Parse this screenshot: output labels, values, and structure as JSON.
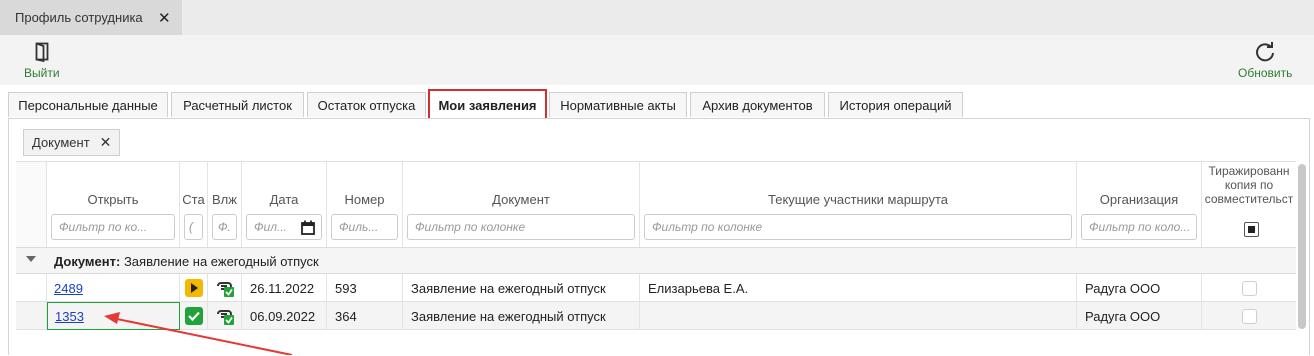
{
  "doc_tab": {
    "title": "Профиль сотрудника"
  },
  "toolbar": {
    "exit_label": "Выйти",
    "refresh_label": "Обновить"
  },
  "tabs": [
    {
      "label": "Персональные данные"
    },
    {
      "label": "Расчетный листок"
    },
    {
      "label": "Остаток отпуска"
    },
    {
      "label": "Мои заявления"
    },
    {
      "label": "Нормативные акты"
    },
    {
      "label": "Архив документов"
    },
    {
      "label": "История операций"
    }
  ],
  "grouping_chip": {
    "label": "Документ"
  },
  "columns": {
    "open": {
      "label": "Открыть",
      "filter": "Фильтр по ко..."
    },
    "status": {
      "label": "Ста"
    },
    "attach": {
      "label": "Влж"
    },
    "date": {
      "label": "Дата",
      "filter": "Фил..."
    },
    "number": {
      "label": "Номер",
      "filter": "Филь..."
    },
    "document": {
      "label": "Документ",
      "filter": "Фильтр по колонке"
    },
    "participants": {
      "label": "Текущие участники маршрута",
      "filter": "Фильтр по колонке"
    },
    "org": {
      "label": "Организация",
      "filter": "Фильтр по коло..."
    },
    "copy": {
      "label_line1": "Тиражированн",
      "label_line2": "копия по",
      "label_line3": "совместительст"
    }
  },
  "group": {
    "key": "Документ:",
    "value": "Заявление на ежегодный отпуск"
  },
  "rows": [
    {
      "open": "2489",
      "status": "in-progress",
      "date": "26.11.2022",
      "number": "593",
      "document": "Заявление на ежегодный отпуск",
      "participants": "Елизарьева Е.А.",
      "org": "Радуга ООО"
    },
    {
      "open": "1353",
      "status": "approved",
      "date": "06.09.2022",
      "number": "364",
      "document": "Заявление на ежегодный отпуск",
      "participants": "",
      "org": "Радуга ООО"
    }
  ],
  "colors": {
    "accent_green": "#2e7d32",
    "status_yellow": "#f5b800",
    "status_green": "#21a33a",
    "highlight_red": "#d32f2f",
    "link_blue": "#1a3fc4"
  }
}
